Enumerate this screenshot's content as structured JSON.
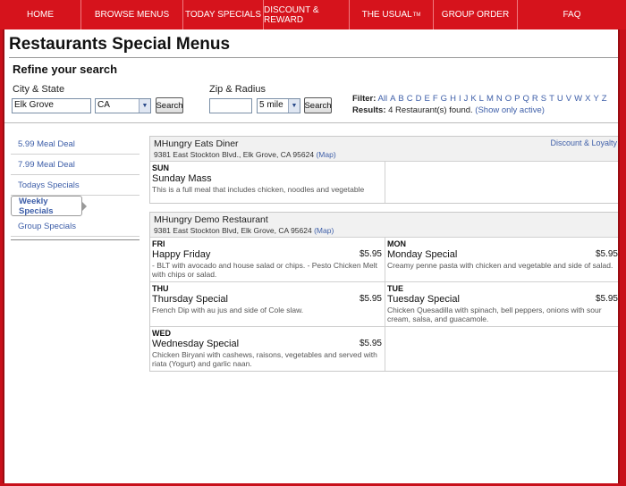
{
  "nav": [
    {
      "label": "HOME",
      "sup": ""
    },
    {
      "label": "BROWSE MENUS",
      "sup": ""
    },
    {
      "label": "TODAY SPECIALS",
      "sup": ""
    },
    {
      "label": "DISCOUNT & REWARD",
      "sup": ""
    },
    {
      "label": "THE USUAL",
      "sup": "TM"
    },
    {
      "label": "GROUP ORDER",
      "sup": ""
    },
    {
      "label": "FAQ",
      "sup": ""
    }
  ],
  "page": {
    "title": "Restaurants Special Menus"
  },
  "search": {
    "heading": "Refine your search",
    "city_state_label": "City & State",
    "city_value": "Elk Grove",
    "state_value": "CA",
    "search_label": "Search",
    "zip_radius_label": "Zip & Radius",
    "zip_value": "",
    "radius_value": "5 mile"
  },
  "filter": {
    "label": "Filter:",
    "all": "All",
    "letters": [
      "A",
      "B",
      "C",
      "D",
      "E",
      "F",
      "G",
      "H",
      "I",
      "J",
      "K",
      "L",
      "M",
      "N",
      "O",
      "P",
      "Q",
      "R",
      "S",
      "T",
      "U",
      "V",
      "W",
      "X",
      "Y",
      "Z"
    ],
    "results_label": "Results:",
    "results_text": "4 Restaurant(s) found.",
    "show_active": "(Show only active)"
  },
  "sidebar": [
    {
      "label": "5.99 Meal Deal",
      "active": false
    },
    {
      "label": "7.99 Meal Deal",
      "active": false
    },
    {
      "label": "Todays Specials",
      "active": false
    },
    {
      "label": "Weekly Specials",
      "active": true
    },
    {
      "label": "Group Specials",
      "active": false
    }
  ],
  "restaurants": [
    {
      "name": "MHungry Eats Diner",
      "address": "9381 East Stockton Blvd., Elk Grove, CA 95624",
      "map_label": "(Map)",
      "discount_link": "Discount & Loyalty",
      "specials": [
        {
          "day": "SUN",
          "dish": "Sunday Mass",
          "desc": "This is a full meal that includes chicken, noodles and vegetable",
          "price": ""
        },
        {
          "day": "",
          "dish": "",
          "desc": "",
          "price": ""
        }
      ]
    },
    {
      "name": "MHungry Demo Restaurant",
      "address": "9381 East Stockton Blvd, Elk Grove, CA 95624",
      "map_label": "(Map)",
      "discount_link": "",
      "specials": [
        {
          "day": "FRI",
          "dish": "Happy Friday",
          "desc": "- BLT with avocado and house salad or chips. - Pesto Chicken Melt with chips or salad.",
          "price": "$5.95"
        },
        {
          "day": "MON",
          "dish": "Monday Special",
          "desc": "Creamy penne pasta with chicken and vegetable and side of salad.",
          "price": "$5.95"
        },
        {
          "day": "THU",
          "dish": "Thursday Special",
          "desc": "French Dip with au jus and side of Cole slaw.",
          "price": "$5.95"
        },
        {
          "day": "TUE",
          "dish": "Tuesday Special",
          "desc": "Chicken Quesadilla with spinach, bell peppers, onions with sour cream, salsa, and guacamole.",
          "price": "$5.95"
        },
        {
          "day": "WED",
          "dish": "Wednesday Special",
          "desc": "Chicken Biryani with cashews, raisons, vegetables and served with riata (Yogurt) and garlic naan.",
          "price": "$5.95"
        },
        {
          "day": "",
          "dish": "",
          "desc": "",
          "price": ""
        }
      ]
    }
  ]
}
